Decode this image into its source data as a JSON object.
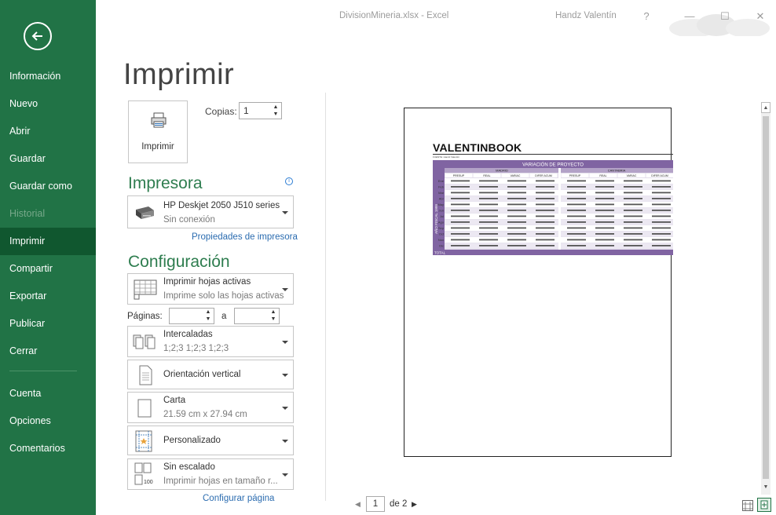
{
  "window": {
    "title": "DivisionMineria.xlsx - Excel",
    "user": "Handz Valentín",
    "help": "?",
    "minimize": "—",
    "restore": "☐",
    "close": "✕"
  },
  "sidebar": {
    "items": [
      {
        "label": "Información"
      },
      {
        "label": "Nuevo"
      },
      {
        "label": "Abrir"
      },
      {
        "label": "Guardar"
      },
      {
        "label": "Guardar como"
      },
      {
        "label": "Historial"
      },
      {
        "label": "Imprimir"
      },
      {
        "label": "Compartir"
      },
      {
        "label": "Exportar"
      },
      {
        "label": "Publicar"
      },
      {
        "label": "Cerrar"
      },
      {
        "label": "Cuenta"
      },
      {
        "label": "Opciones"
      },
      {
        "label": "Comentarios"
      }
    ]
  },
  "print": {
    "title": "Imprimir",
    "button_label": "Imprimir",
    "copies_label": "Copias:",
    "copies_value": "1"
  },
  "printer": {
    "section_title": "Impresora",
    "info": "i",
    "name": "HP Deskjet 2050 J510 series",
    "status": "Sin conexión",
    "properties_link": "Propiedades de impresora"
  },
  "settings": {
    "section_title": "Configuración",
    "what": {
      "main": "Imprimir hojas activas",
      "sub": "Imprime solo las hojas activas"
    },
    "pages_label": "Páginas:",
    "pages_to": "a",
    "collate": {
      "main": "Intercaladas",
      "sub": "1;2;3    1;2;3    1;2;3"
    },
    "orientation": {
      "main": "Orientación vertical"
    },
    "paper": {
      "main": "Carta",
      "sub": "21.59 cm x 27.94 cm"
    },
    "margins": {
      "main": "Personalizado"
    },
    "scaling": {
      "main": "Sin escalado",
      "sub": "Imprimir hojas en tamaño r..."
    },
    "scaling_icon_text": "100",
    "page_setup_link": "Configurar página"
  },
  "preview": {
    "current_page": "1",
    "of_label": "de 2",
    "sheet": {
      "title": "VALENTINBOOK",
      "caption": "FUENTE: Handz Valentín",
      "header": "VARIACIÓN DE PROYECTO",
      "regions": [
        "MADRID",
        "CANTABRIA"
      ],
      "columns": [
        "PRESUP",
        "REAL",
        "VARIAC",
        "DIFER ACUM"
      ],
      "side_label": "AÑO FISCAL 1999",
      "months": [
        "Ene",
        "Feb",
        "Mar",
        "Abr",
        "May",
        "Jun",
        "Jul",
        "Ago",
        "Sep",
        "Oct",
        "Nov",
        "Dic"
      ],
      "total_label": "TOTAL"
    }
  },
  "colors": {
    "sidebar": "#217346",
    "sidebar_active": "#10572f",
    "accent_text": "#2e7d4f",
    "link": "#2b6cb0",
    "table_header": "#8064a2",
    "table_header_light": "#b3a2c7",
    "table_body": "#e4dfec"
  }
}
